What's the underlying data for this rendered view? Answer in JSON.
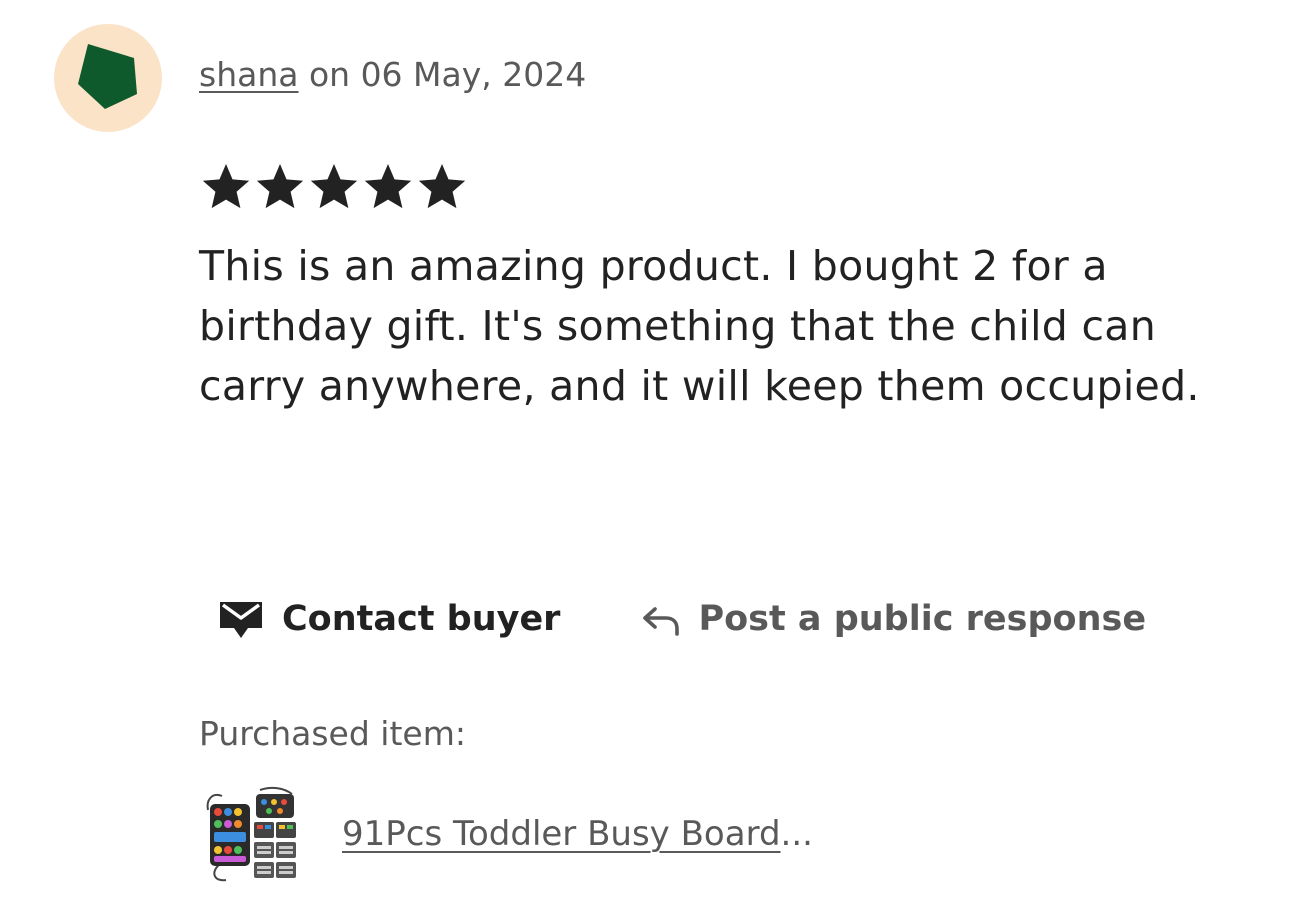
{
  "review": {
    "reviewer_name": "shana",
    "date_text": "on 06 May, 2024",
    "rating": 5,
    "rating_max": 5,
    "text": "This is an amazing product. I bought 2 for a birthday gift. It's something that the child can carry anywhere, and it will keep them occupied."
  },
  "avatar": {
    "background_color": "#fbe3c8",
    "shape_color": "#0f5a2c"
  },
  "actions": {
    "contact_label": "Contact buyer",
    "contact_icon": "envelope-icon",
    "respond_label": "Post a public response",
    "respond_icon": "reply-arrow-icon"
  },
  "purchase": {
    "heading": "Purchased item:",
    "item_title": "91Pcs Toddler Busy Board",
    "item_ellipsis": "..."
  }
}
